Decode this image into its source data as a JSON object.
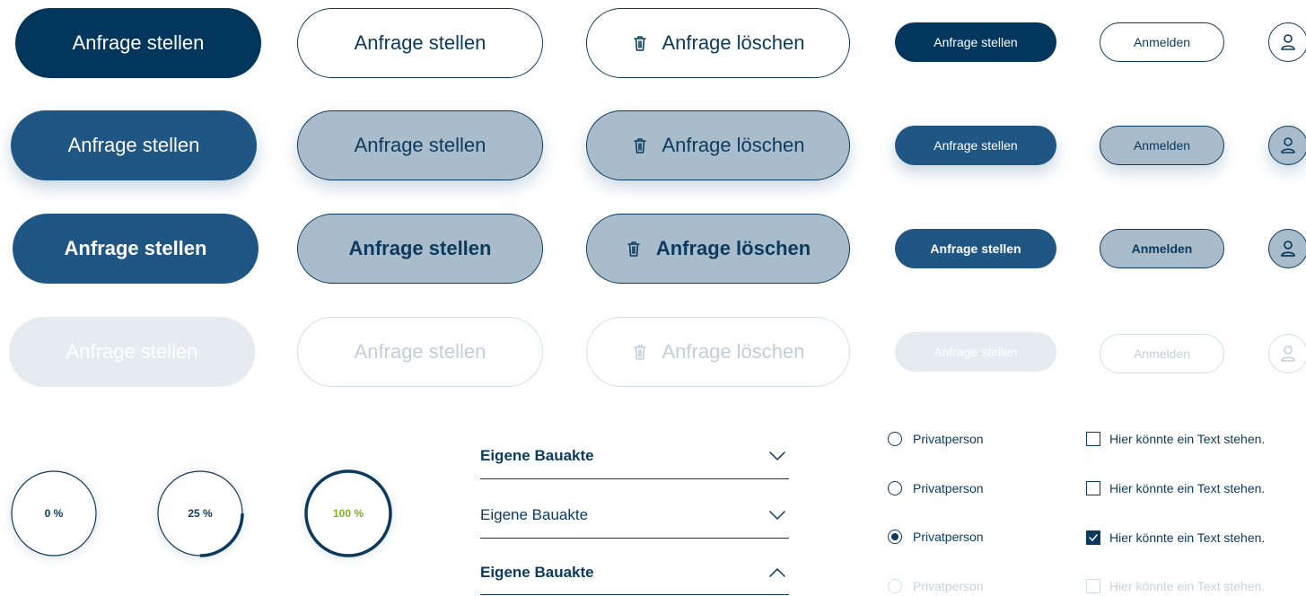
{
  "buttons": {
    "request_label": "Anfrage stellen",
    "delete_label": "Anfrage löschen",
    "login_label": "Anmelden"
  },
  "icons": {
    "delete": "trash-icon",
    "user": "user-icon",
    "chevron_down": "chevron-down-icon",
    "chevron_up": "chevron-up-icon",
    "check": "check-icon"
  },
  "progress": [
    {
      "label": "0 %",
      "value": 0
    },
    {
      "label": "25 %",
      "value": 0.25
    },
    {
      "label": "100 %",
      "value": 1.0
    }
  ],
  "accordion": {
    "items": [
      {
        "label": "Eigene Bauakte",
        "state": "collapsed"
      },
      {
        "label": "Eigene Bauakte",
        "state": "collapsed"
      },
      {
        "label": "Eigene Bauakte",
        "state": "expanded"
      }
    ]
  },
  "radios": {
    "label": "Privatperson",
    "states": [
      "unchecked",
      "unchecked",
      "checked",
      "disabled"
    ]
  },
  "checkboxes": {
    "label": "Hier könnte ein Text stehen.",
    "states": [
      "unchecked",
      "unchecked",
      "checked",
      "disabled"
    ]
  },
  "colors": {
    "primary": "#03365d",
    "primary_hover": "#1f5683",
    "outline_hover_fill": "#a8bccb",
    "disabled_fill": "#e5ebf0",
    "success_green": "#7ab51d"
  }
}
